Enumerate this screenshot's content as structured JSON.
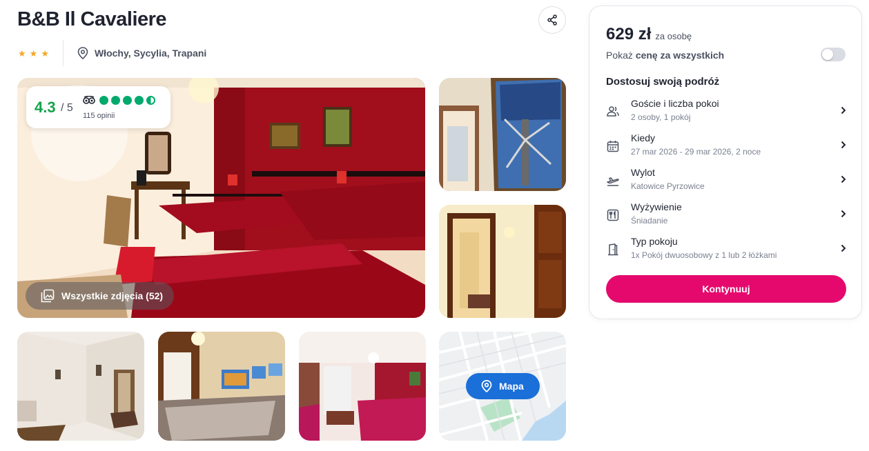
{
  "hotel": {
    "name": "B&B Il Cavaliere",
    "stars": [
      "★",
      "★",
      "★"
    ],
    "location": "Włochy, Sycylia, Trapani"
  },
  "rating": {
    "score": "4.3",
    "max": "/ 5",
    "reviews": "115 opinii",
    "bubbles": 4.5
  },
  "gallery": {
    "all_photos_label": "Wszystkie zdjęcia (52)",
    "map_label": "Mapa"
  },
  "booking": {
    "price": "629 zł",
    "price_per": "za osobę",
    "show_total_prefix": "Pokaż",
    "show_total_bold": "cenę za wszystkich",
    "section_title": "Dostosuj swoją podróż",
    "options": [
      {
        "label": "Goście i liczba pokoi",
        "value": "2 osoby, 1 pokój",
        "icon": "guests-icon"
      },
      {
        "label": "Kiedy",
        "value": "27 mar 2026 - 29 mar 2026, 2 noce",
        "icon": "calendar-icon"
      },
      {
        "label": "Wylot",
        "value": "Katowice Pyrzowice",
        "icon": "plane-departure-icon"
      },
      {
        "label": "Wyżywienie",
        "value": "Śniadanie",
        "icon": "meal-icon"
      },
      {
        "label": "Typ pokoju",
        "value": "1x Pokój dwuosobowy z 1 lub 2 łóżkami",
        "icon": "room-door-icon"
      }
    ],
    "continue_label": "Kontynuuj"
  },
  "colors": {
    "accent": "#e5096e",
    "rating_green": "#16a34a",
    "tripadvisor_green": "#00aa6c",
    "map_button": "#1a6fd8",
    "star": "#f5a623"
  }
}
